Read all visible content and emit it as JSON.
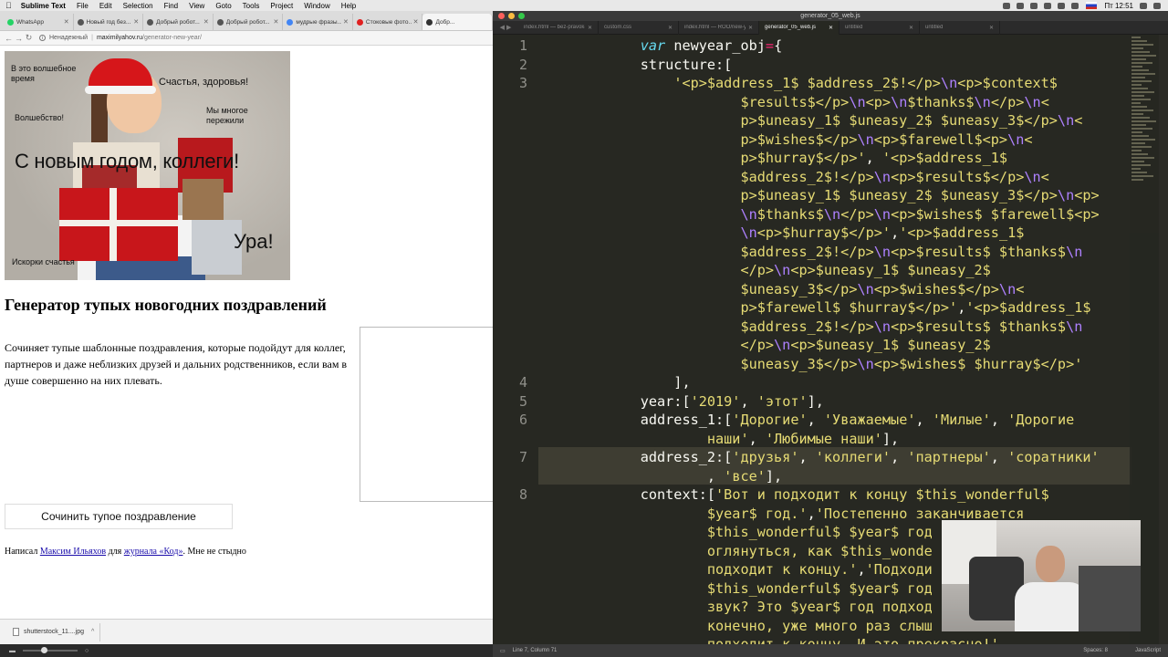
{
  "menubar": {
    "app": "Sublime Text",
    "items": [
      "File",
      "Edit",
      "Selection",
      "Find",
      "View",
      "Goto",
      "Tools",
      "Project",
      "Window",
      "Help"
    ],
    "clock": "Пт 12:51"
  },
  "browser": {
    "tabs": [
      {
        "label": "WhatsApp",
        "color": "#25d366"
      },
      {
        "label": "Новый год без...",
        "color": "#555555"
      },
      {
        "label": "Добрый робот...",
        "color": "#555555"
      },
      {
        "label": "Добрый робот...",
        "color": "#555555"
      },
      {
        "label": "мудрые фразы...",
        "color": "#4285f4"
      },
      {
        "label": "Стоковые фото...",
        "color": "#e02020"
      },
      {
        "label": "Добр...",
        "color": "#333333"
      }
    ],
    "security": "Ненадежный",
    "url_host": "maximilyahov.ru",
    "url_path": "/generator-new-year/"
  },
  "hero": {
    "line1": "В это волшебное время",
    "line2": "Счастья, здоровья!",
    "line3": "Мы многое пережили",
    "line4": "Волшебство!",
    "main": "С новым годом, коллеги!",
    "hurray": "Ура!",
    "sparks": "Искорки счастья"
  },
  "page": {
    "title": "Генератор тупых новогодних поздравлений",
    "description": "Сочиняет тупые шаблонные поздравления, которые подойдут для коллег, партнеров и даже неблизких друзей и дальних родственников, если вам в душе совершенно на них плевать.",
    "button": "Сочинить тупое поздравление",
    "credits_pre": "Написал ",
    "credits_author": "Максим Ильяхов",
    "credits_mid": " для ",
    "credits_journal": "журнала «Код»",
    "credits_post": ". Мне не стыдно"
  },
  "downloads": {
    "file": "shutterstock_11....jpg"
  },
  "editor": {
    "window_title": "generator_05_web.js",
    "tabs": [
      {
        "label": "index.html — bez-pravok-bundle/clients-site",
        "active": false
      },
      {
        "label": "custom.css",
        "active": false
      },
      {
        "label": "index.html — ROO/new-year",
        "active": false
      },
      {
        "label": "generator_05_web.js",
        "active": true
      },
      {
        "label": "untitled",
        "active": false
      },
      {
        "label": "untitled",
        "active": false
      }
    ],
    "line_numbers": [
      {
        "n": "1",
        "row": 0
      },
      {
        "n": "2",
        "row": 1
      },
      {
        "n": "3",
        "row": 2
      },
      {
        "n": "4",
        "row": 18
      },
      {
        "n": "5",
        "row": 19
      },
      {
        "n": "6",
        "row": 20
      },
      {
        "n": "7",
        "row": 22
      },
      {
        "n": "8",
        "row": 24
      }
    ],
    "lines": [
      [
        [
          "",
          "            "
        ],
        [
          "kw",
          "var"
        ],
        [
          "",
          " newyear_obj"
        ],
        [
          "op",
          "="
        ],
        [
          "",
          "{"
        ]
      ],
      [
        [
          "",
          "            structure:["
        ]
      ],
      [
        [
          "",
          "                "
        ],
        [
          "str",
          "'<p>$address_1$ $address_2$!</p>"
        ],
        [
          "esc",
          "\\n"
        ],
        [
          "str",
          "<p>$context$"
        ]
      ],
      [
        [
          "",
          "                        "
        ],
        [
          "str",
          "$results$</p>"
        ],
        [
          "esc",
          "\\n"
        ],
        [
          "str",
          "<p>"
        ],
        [
          "esc",
          "\\n"
        ],
        [
          "str",
          "$thanks$"
        ],
        [
          "esc",
          "\\n"
        ],
        [
          "str",
          "</p>"
        ],
        [
          "esc",
          "\\n"
        ],
        [
          "str",
          "<"
        ]
      ],
      [
        [
          "",
          "                        "
        ],
        [
          "str",
          "p>$uneasy_1$ $uneasy_2$ $uneasy_3$</p>"
        ],
        [
          "esc",
          "\\n"
        ],
        [
          "str",
          "<"
        ]
      ],
      [
        [
          "",
          "                        "
        ],
        [
          "str",
          "p>$wishes$</p>"
        ],
        [
          "esc",
          "\\n"
        ],
        [
          "str",
          "<p>$farewell$<p>"
        ],
        [
          "esc",
          "\\n"
        ],
        [
          "str",
          "<"
        ]
      ],
      [
        [
          "",
          "                        "
        ],
        [
          "str",
          "p>$hurray$</p>'"
        ],
        [
          "",
          ", "
        ],
        [
          "str",
          "'<p>$address_1$"
        ]
      ],
      [
        [
          "",
          "                        "
        ],
        [
          "str",
          "$address_2$!</p>"
        ],
        [
          "esc",
          "\\n"
        ],
        [
          "str",
          "<p>$results$</p>"
        ],
        [
          "esc",
          "\\n"
        ],
        [
          "str",
          "<"
        ]
      ],
      [
        [
          "",
          "                        "
        ],
        [
          "str",
          "p>$uneasy_1$ $uneasy_2$ $uneasy_3$</p>"
        ],
        [
          "esc",
          "\\n"
        ],
        [
          "str",
          "<p>"
        ]
      ],
      [
        [
          "",
          "                        "
        ],
        [
          "esc",
          "\\n"
        ],
        [
          "str",
          "$thanks$"
        ],
        [
          "esc",
          "\\n"
        ],
        [
          "str",
          "</p>"
        ],
        [
          "esc",
          "\\n"
        ],
        [
          "str",
          "<p>$wishes$ $farewell$<p>"
        ]
      ],
      [
        [
          "",
          "                        "
        ],
        [
          "esc",
          "\\n"
        ],
        [
          "str",
          "<p>$hurray$</p>'"
        ],
        [
          "",
          ","
        ],
        [
          "str",
          "'<p>$address_1$"
        ]
      ],
      [
        [
          "",
          "                        "
        ],
        [
          "str",
          "$address_2$!</p>"
        ],
        [
          "esc",
          "\\n"
        ],
        [
          "str",
          "<p>$results$ $thanks$"
        ],
        [
          "esc",
          "\\n"
        ]
      ],
      [
        [
          "",
          "                        "
        ],
        [
          "str",
          "</p>"
        ],
        [
          "esc",
          "\\n"
        ],
        [
          "str",
          "<p>$uneasy_1$ $uneasy_2$"
        ]
      ],
      [
        [
          "",
          "                        "
        ],
        [
          "str",
          "$uneasy_3$</p>"
        ],
        [
          "esc",
          "\\n"
        ],
        [
          "str",
          "<p>$wishes$</p>"
        ],
        [
          "esc",
          "\\n"
        ],
        [
          "str",
          "<"
        ]
      ],
      [
        [
          "",
          "                        "
        ],
        [
          "str",
          "p>$farewell$ $hurray$</p>'"
        ],
        [
          "",
          ","
        ],
        [
          "str",
          "'<p>$address_1$"
        ]
      ],
      [
        [
          "",
          "                        "
        ],
        [
          "str",
          "$address_2$!</p>"
        ],
        [
          "esc",
          "\\n"
        ],
        [
          "str",
          "<p>$results$ $thanks$"
        ],
        [
          "esc",
          "\\n"
        ]
      ],
      [
        [
          "",
          "                        "
        ],
        [
          "str",
          "</p>"
        ],
        [
          "esc",
          "\\n"
        ],
        [
          "str",
          "<p>$uneasy_1$ $uneasy_2$"
        ]
      ],
      [
        [
          "",
          "                        "
        ],
        [
          "str",
          "$uneasy_3$</p>"
        ],
        [
          "esc",
          "\\n"
        ],
        [
          "str",
          "<p>$wishes$ $hurray$</p>'"
        ]
      ],
      [
        [
          "",
          "                ],"
        ]
      ],
      [
        [
          "",
          "            year:["
        ],
        [
          "str",
          "'2019'"
        ],
        [
          "",
          ", "
        ],
        [
          "str",
          "'этот'"
        ],
        [
          "",
          "],"
        ]
      ],
      [
        [
          "",
          "            address_1:["
        ],
        [
          "str",
          "'Дорогие'"
        ],
        [
          "",
          ", "
        ],
        [
          "str",
          "'Уважаемые'"
        ],
        [
          "",
          ", "
        ],
        [
          "str",
          "'Милые'"
        ],
        [
          "",
          ", "
        ],
        [
          "str",
          "'Дорогие"
        ]
      ],
      [
        [
          "",
          "                    "
        ],
        [
          "str",
          "наши'"
        ],
        [
          "",
          ", "
        ],
        [
          "str",
          "'Любимые наши'"
        ],
        [
          "",
          "],"
        ]
      ],
      [
        [
          "",
          "            address_2:["
        ],
        [
          "str",
          "'друзья'"
        ],
        [
          "",
          ", "
        ],
        [
          "str",
          "'коллеги'"
        ],
        [
          "",
          ", "
        ],
        [
          "str",
          "'партнеры'"
        ],
        [
          "",
          ", "
        ],
        [
          "str",
          "'соратники'"
        ]
      ],
      [
        [
          "",
          "                    , "
        ],
        [
          "str",
          "'все'"
        ],
        [
          "",
          "],"
        ]
      ],
      [
        [
          "",
          "            context:["
        ],
        [
          "str",
          "'Вот и подходит к концу $this_wonderful$"
        ]
      ],
      [
        [
          "",
          "                    "
        ],
        [
          "str",
          "$year$ год.'"
        ],
        [
          "",
          ","
        ],
        [
          "str",
          "'Постепенно заканчивается"
        ]
      ],
      [
        [
          "",
          "                    "
        ],
        [
          "str",
          "$this_wonderful$ $year$ год"
        ]
      ],
      [
        [
          "",
          "                    "
        ],
        [
          "str",
          "оглянуться, как $this_wonde"
        ]
      ],
      [
        [
          "",
          "                    "
        ],
        [
          "str",
          "подходит к концу.'"
        ],
        [
          "",
          ","
        ],
        [
          "str",
          "'Подходи"
        ]
      ],
      [
        [
          "",
          "                    "
        ],
        [
          "str",
          "$this_wonderful$ $year$ год"
        ]
      ],
      [
        [
          "",
          "                    "
        ],
        [
          "str",
          "звук? Это $year$ год подход"
        ]
      ],
      [
        [
          "",
          "                    "
        ],
        [
          "str",
          "конечно, уже много раз слыш"
        ]
      ],
      [
        [
          "",
          "                    "
        ],
        [
          "str",
          "подходит к концу. И это прекрасно!'"
        ],
        [
          "",
          ","
        ]
      ]
    ],
    "status_left": "Line 7, Column 71",
    "status_spaces": "Spaces: 8",
    "status_syntax": "JavaScript"
  }
}
